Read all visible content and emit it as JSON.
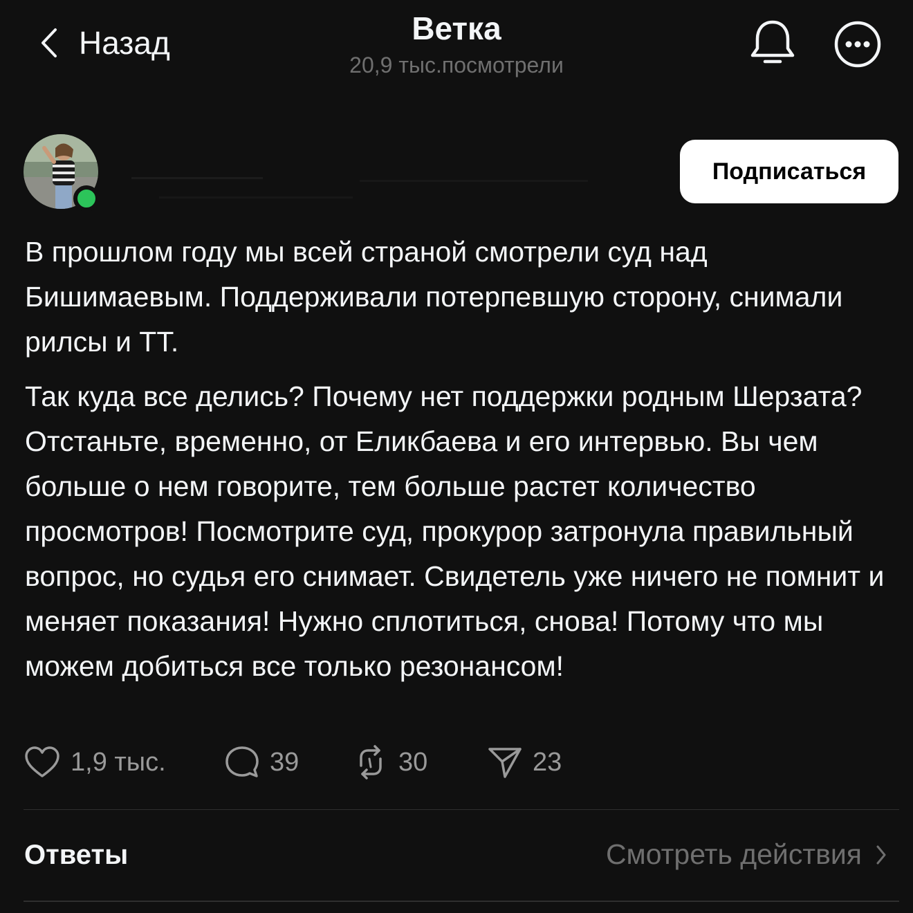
{
  "header": {
    "back_label": "Назад",
    "title": "Ветка",
    "views": "20,9 тыс.посмотрели"
  },
  "post": {
    "subscribe_label": "Подписаться",
    "paragraphs": [
      "В прошлом году мы всей страной смотрели суд над Бишимаевым. Поддерживали потерпевшую сторону, снимали рилсы и ТТ.",
      "Так куда все делись? Почему нет поддержки родным Шерзата? Отстаньте, временно, от Еликбаева и его интервью. Вы чем больше о нем говорите, тем больше растет количество просмотров! Посмотрите суд, прокурор затронула правильный вопрос, но судья его снимает. Свидетель уже ничего не помнит и меняет показания! Нужно сплотиться, снова! Потому что мы можем добиться все только резонансом!"
    ],
    "stats": {
      "likes": "1,9 тыс.",
      "comments": "39",
      "reposts": "30",
      "shares": "23"
    }
  },
  "footer": {
    "replies_label": "Ответы",
    "activity_label": "Смотреть действия"
  },
  "colors": {
    "background": "#101010",
    "text": "#f3f5f7",
    "muted": "#6f6f6f",
    "online": "#2cc45a"
  },
  "icons": [
    "chevron-left-icon",
    "bell-icon",
    "more-icon",
    "heart-icon",
    "comment-icon",
    "repost-icon",
    "share-icon",
    "chevron-right-icon"
  ]
}
